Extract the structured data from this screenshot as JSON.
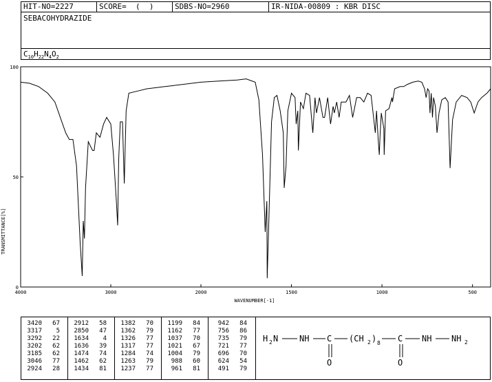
{
  "header": {
    "hit_no": "HIT-NO=2227",
    "score": "SCORE=  (  )",
    "sdbs_no": "SDBS-NO=2960",
    "ir_info": "IR-NIDA-00809 : KBR DISC"
  },
  "compound": {
    "name": "SEBACOHYDRAZIDE",
    "formula_parts": [
      "C",
      "10",
      "H",
      "22",
      "N",
      "4",
      "O",
      "2"
    ]
  },
  "chart_data": {
    "type": "line",
    "xlabel": "WAVENUMBER[-1]",
    "ylabel": "TRANSMITTANCE[%]",
    "xlim": [
      4000,
      400
    ],
    "ylim": [
      0,
      100
    ],
    "x_ticks": [
      "4000",
      "3000",
      "2000",
      "1500",
      "1000",
      "500"
    ],
    "y_ticks": [
      "100",
      "50",
      "0"
    ],
    "x_tick_values": [
      4000,
      3000,
      2000,
      1500,
      1000,
      500
    ],
    "y_tick_values": [
      100,
      50,
      0
    ],
    "spectrum": [
      [
        4000,
        93
      ],
      [
        3900,
        92.5
      ],
      [
        3800,
        91
      ],
      [
        3700,
        88
      ],
      [
        3620,
        84
      ],
      [
        3560,
        77
      ],
      [
        3500,
        70
      ],
      [
        3460,
        67
      ],
      [
        3420,
        67
      ],
      [
        3380,
        55
      ],
      [
        3340,
        20
      ],
      [
        3317,
        5
      ],
      [
        3305,
        30
      ],
      [
        3292,
        22
      ],
      [
        3280,
        45
      ],
      [
        3250,
        66
      ],
      [
        3202,
        62
      ],
      [
        3185,
        62
      ],
      [
        3160,
        70
      ],
      [
        3120,
        68
      ],
      [
        3080,
        74
      ],
      [
        3046,
        77
      ],
      [
        3000,
        74
      ],
      [
        2970,
        60
      ],
      [
        2940,
        40
      ],
      [
        2924,
        28
      ],
      [
        2912,
        58
      ],
      [
        2895,
        75
      ],
      [
        2870,
        75
      ],
      [
        2850,
        47
      ],
      [
        2830,
        80
      ],
      [
        2800,
        88
      ],
      [
        2700,
        89
      ],
      [
        2600,
        90
      ],
      [
        2500,
        90.5
      ],
      [
        2400,
        91
      ],
      [
        2300,
        91.5
      ],
      [
        2200,
        92
      ],
      [
        2100,
        92.5
      ],
      [
        2000,
        93
      ],
      [
        1900,
        93.5
      ],
      [
        1800,
        94
      ],
      [
        1750,
        94.5
      ],
      [
        1700,
        93
      ],
      [
        1680,
        85
      ],
      [
        1660,
        60
      ],
      [
        1645,
        25
      ],
      [
        1636,
        39
      ],
      [
        1634,
        4
      ],
      [
        1625,
        30
      ],
      [
        1610,
        75
      ],
      [
        1595,
        86
      ],
      [
        1580,
        87
      ],
      [
        1562,
        80
      ],
      [
        1545,
        70
      ],
      [
        1540,
        45
      ],
      [
        1530,
        55
      ],
      [
        1520,
        80
      ],
      [
        1500,
        88
      ],
      [
        1480,
        86
      ],
      [
        1474,
        74
      ],
      [
        1465,
        80
      ],
      [
        1462,
        62
      ],
      [
        1450,
        84
      ],
      [
        1434,
        81
      ],
      [
        1420,
        88
      ],
      [
        1400,
        87
      ],
      [
        1382,
        70
      ],
      [
        1370,
        86
      ],
      [
        1362,
        79
      ],
      [
        1345,
        86
      ],
      [
        1326,
        77
      ],
      [
        1317,
        77
      ],
      [
        1300,
        86
      ],
      [
        1284,
        74
      ],
      [
        1270,
        82
      ],
      [
        1263,
        79
      ],
      [
        1250,
        84
      ],
      [
        1237,
        77
      ],
      [
        1225,
        84
      ],
      [
        1199,
        84
      ],
      [
        1180,
        87
      ],
      [
        1162,
        77
      ],
      [
        1140,
        86
      ],
      [
        1120,
        86
      ],
      [
        1100,
        84
      ],
      [
        1080,
        88
      ],
      [
        1060,
        87
      ],
      [
        1037,
        70
      ],
      [
        1030,
        80
      ],
      [
        1021,
        67
      ],
      [
        1015,
        60
      ],
      [
        1010,
        70
      ],
      [
        1004,
        79
      ],
      [
        990,
        72
      ],
      [
        988,
        60
      ],
      [
        980,
        80
      ],
      [
        961,
        81
      ],
      [
        945,
        86
      ],
      [
        942,
        84
      ],
      [
        930,
        90
      ],
      [
        900,
        91
      ],
      [
        880,
        91
      ],
      [
        860,
        92
      ],
      [
        830,
        93
      ],
      [
        800,
        93.5
      ],
      [
        780,
        93
      ],
      [
        765,
        90
      ],
      [
        756,
        86
      ],
      [
        748,
        90
      ],
      [
        740,
        89
      ],
      [
        735,
        79
      ],
      [
        728,
        88
      ],
      [
        721,
        77
      ],
      [
        715,
        86
      ],
      [
        705,
        82
      ],
      [
        696,
        70
      ],
      [
        685,
        79
      ],
      [
        670,
        85
      ],
      [
        650,
        86
      ],
      [
        635,
        84
      ],
      [
        624,
        54
      ],
      [
        610,
        76
      ],
      [
        590,
        84
      ],
      [
        560,
        87
      ],
      [
        530,
        86
      ],
      [
        510,
        84
      ],
      [
        491,
        79
      ],
      [
        470,
        84
      ],
      [
        450,
        86
      ],
      [
        420,
        88
      ],
      [
        400,
        90
      ]
    ]
  },
  "peak_table": [
    [
      [
        "3420",
        "67"
      ],
      [
        "3317",
        "5"
      ],
      [
        "3292",
        "22"
      ],
      [
        "3202",
        "62"
      ],
      [
        "3185",
        "62"
      ],
      [
        "3046",
        "77"
      ],
      [
        "2924",
        "28"
      ]
    ],
    [
      [
        "2912",
        "58"
      ],
      [
        "2850",
        "47"
      ],
      [
        "1634",
        "4"
      ],
      [
        "1636",
        "39"
      ],
      [
        "1474",
        "74"
      ],
      [
        "1462",
        "62"
      ],
      [
        "1434",
        "81"
      ]
    ],
    [
      [
        "1382",
        "70"
      ],
      [
        "1362",
        "79"
      ],
      [
        "1326",
        "77"
      ],
      [
        "1317",
        "77"
      ],
      [
        "1284",
        "74"
      ],
      [
        "1263",
        "79"
      ],
      [
        "1237",
        "77"
      ]
    ],
    [
      [
        "1199",
        "84"
      ],
      [
        "1162",
        "77"
      ],
      [
        "1037",
        "70"
      ],
      [
        "1021",
        "67"
      ],
      [
        "1004",
        "79"
      ],
      [
        "988",
        "60"
      ],
      [
        "961",
        "81"
      ]
    ],
    [
      [
        "942",
        "84"
      ],
      [
        "756",
        "86"
      ],
      [
        "735",
        "79"
      ],
      [
        "721",
        "77"
      ],
      [
        "696",
        "70"
      ],
      [
        "624",
        "54"
      ],
      [
        "491",
        "79"
      ]
    ]
  ],
  "structure": {
    "left_h": "H",
    "left_sub": "2",
    "left_n": "N",
    "nh1": "NH",
    "c1": "C",
    "chain_open": "(CH",
    "chain_sub": "2",
    "chain_close": ")",
    "chain_count": "8",
    "c2": "C",
    "nh2": "NH",
    "right_n": "NH",
    "right_sub": "2",
    "o1": "O",
    "o2": "O"
  }
}
